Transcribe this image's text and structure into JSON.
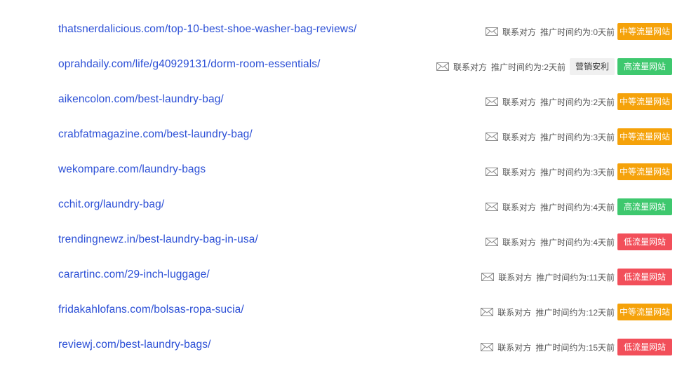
{
  "rows": [
    {
      "url": "thatsnerdalicious.com/top-10-best-shoe-washer-bag-reviews/",
      "contact": "联系对方",
      "time": "推广时间约为:0天前",
      "extra_tag": "",
      "badge": "中等流量网站",
      "badge_color": "#f5a20a"
    },
    {
      "url": "oprahdaily.com/life/g40929131/dorm-room-essentials/",
      "contact": "联系对方",
      "time": "推广时间约为:2天前",
      "extra_tag": "营销安利",
      "badge": "高流量网站",
      "badge_color": "#3ec86e"
    },
    {
      "url": "aikencolon.com/best-laundry-bag/",
      "contact": "联系对方",
      "time": "推广时间约为:2天前",
      "extra_tag": "",
      "badge": "中等流量网站",
      "badge_color": "#f5a20a"
    },
    {
      "url": "crabfatmagazine.com/best-laundry-bag/",
      "contact": "联系对方",
      "time": "推广时间约为:3天前",
      "extra_tag": "",
      "badge": "中等流量网站",
      "badge_color": "#f5a20a"
    },
    {
      "url": "wekompare.com/laundry-bags",
      "contact": "联系对方",
      "time": "推广时间约为:3天前",
      "extra_tag": "",
      "badge": "中等流量网站",
      "badge_color": "#f5a20a"
    },
    {
      "url": "cchit.org/laundry-bag/",
      "contact": "联系对方",
      "time": "推广时间约为:4天前",
      "extra_tag": "",
      "badge": "高流量网站",
      "badge_color": "#3ec86e"
    },
    {
      "url": "trendingnewz.in/best-laundry-bag-in-usa/",
      "contact": "联系对方",
      "time": "推广时间约为:4天前",
      "extra_tag": "",
      "badge": "低流量网站",
      "badge_color": "#f24f5a"
    },
    {
      "url": "carartinc.com/29-inch-luggage/",
      "contact": "联系对方",
      "time": "推广时间约为:11天前",
      "extra_tag": "",
      "badge": "低流量网站",
      "badge_color": "#f24f5a"
    },
    {
      "url": "fridakahlofans.com/bolsas-ropa-sucia/",
      "contact": "联系对方",
      "time": "推广时间约为:12天前",
      "extra_tag": "",
      "badge": "中等流量网站",
      "badge_color": "#f5a20a"
    },
    {
      "url": "reviewj.com/best-laundry-bags/",
      "contact": "联系对方",
      "time": "推广时间约为:15天前",
      "extra_tag": "",
      "badge": "低流量网站",
      "badge_color": "#f24f5a"
    }
  ]
}
